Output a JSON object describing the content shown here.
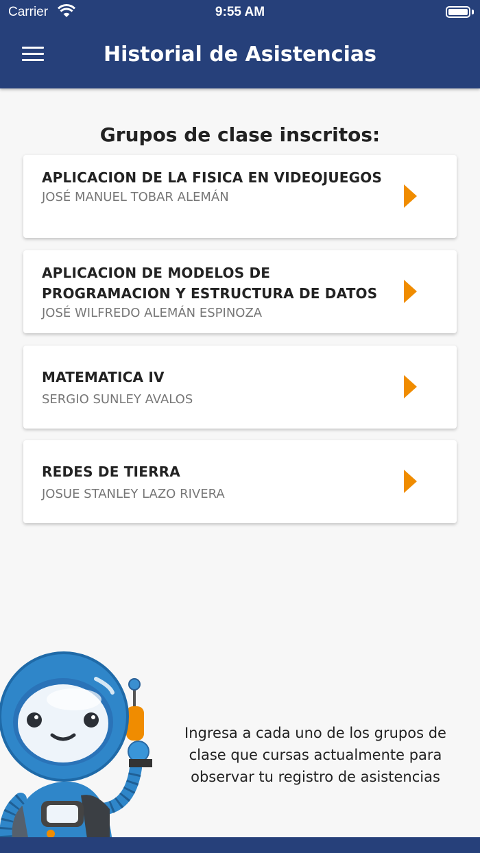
{
  "status_bar": {
    "carrier": "Carrier",
    "time": "9:55 AM"
  },
  "header": {
    "title": "Historial de Asistencias",
    "menu_icon": "hamburger-menu-icon"
  },
  "section_heading": "Grupos de clase inscritos:",
  "groups": [
    {
      "title": "APLICACION DE LA FISICA EN VIDEOJUEGOS",
      "teacher": "JOSÉ MANUEL TOBAR ALEMÁN"
    },
    {
      "title": "APLICACION DE MODELOS DE PROGRAMACION Y ESTRUCTURA DE DATOS",
      "teacher": "JOSÉ WILFREDO ALEMÁN ESPINOZA"
    },
    {
      "title": "MATEMATICA IV",
      "teacher": "SERGIO SUNLEY AVALOS"
    },
    {
      "title": "REDES DE TIERRA",
      "teacher": "JOSUE STANLEY LAZO RIVERA"
    }
  ],
  "help_text": "Ingresa a cada uno de los grupos de clase que cursas actualmente para observar tu registro de asistencias",
  "colors": {
    "primary": "#26407a",
    "accent": "#f08c00",
    "background": "#f7f7f7"
  }
}
